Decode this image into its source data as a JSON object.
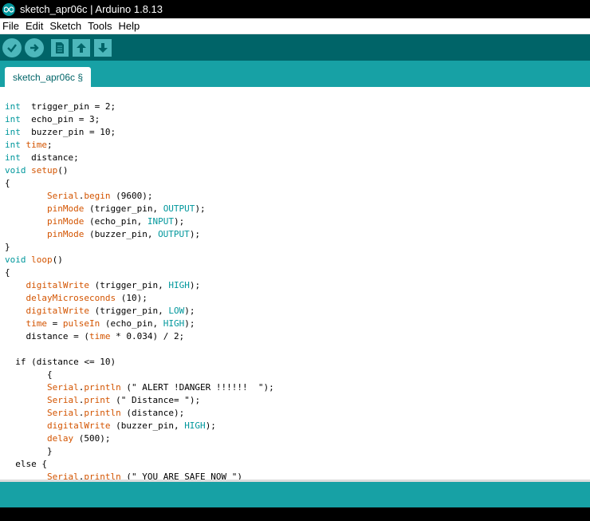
{
  "window": {
    "title": "sketch_apr06c | Arduino 1.8.13"
  },
  "menu": {
    "items": [
      "File",
      "Edit",
      "Sketch",
      "Tools",
      "Help"
    ]
  },
  "toolbar": {
    "buttons": [
      {
        "name": "verify-button",
        "icon": "checkmark-icon"
      },
      {
        "name": "upload-button",
        "icon": "arrow-right-icon"
      },
      {
        "name": "new-button",
        "icon": "document-icon"
      },
      {
        "name": "open-button",
        "icon": "arrow-up-icon"
      },
      {
        "name": "save-button",
        "icon": "arrow-down-icon"
      }
    ]
  },
  "tab": {
    "label": "sketch_apr06c §"
  },
  "colors": {
    "toolbar_bg": "#006468",
    "tab_bar_bg": "#17a1a5",
    "button_bg": "#4db7bb",
    "keyword": "#00979c",
    "function": "#d35400"
  },
  "code": [
    [
      [
        "kw",
        "int"
      ],
      [
        "",
        "  trigger_pin = 2;"
      ]
    ],
    [
      [
        "kw",
        "int"
      ],
      [
        "",
        "  echo_pin = 3;"
      ]
    ],
    [
      [
        "kw",
        "int"
      ],
      [
        "",
        "  buzzer_pin = 10;"
      ]
    ],
    [
      [
        "kw",
        "int"
      ],
      [
        "",
        " "
      ],
      [
        "fn",
        "time"
      ],
      [
        "",
        ";"
      ]
    ],
    [
      [
        "kw",
        "int"
      ],
      [
        "",
        "  distance;"
      ]
    ],
    [
      [
        "kw",
        "void"
      ],
      [
        "",
        " "
      ],
      [
        "fn",
        "setup"
      ],
      [
        "",
        "()"
      ]
    ],
    [
      [
        "",
        "{"
      ]
    ],
    [
      [
        "",
        "        "
      ],
      [
        "fn",
        "Serial"
      ],
      [
        "",
        "."
      ],
      [
        "fn",
        "begin"
      ],
      [
        "",
        " (9600);"
      ]
    ],
    [
      [
        "",
        "        "
      ],
      [
        "fn",
        "pinMode"
      ],
      [
        "",
        " (trigger_pin, "
      ],
      [
        "cn",
        "OUTPUT"
      ],
      [
        "",
        ");"
      ]
    ],
    [
      [
        "",
        "        "
      ],
      [
        "fn",
        "pinMode"
      ],
      [
        "",
        " (echo_pin, "
      ],
      [
        "cn",
        "INPUT"
      ],
      [
        "",
        ");"
      ]
    ],
    [
      [
        "",
        "        "
      ],
      [
        "fn",
        "pinMode"
      ],
      [
        "",
        " (buzzer_pin, "
      ],
      [
        "cn",
        "OUTPUT"
      ],
      [
        "",
        ");"
      ]
    ],
    [
      [
        "",
        "}"
      ]
    ],
    [
      [
        "kw",
        "void"
      ],
      [
        "",
        " "
      ],
      [
        "fn",
        "loop"
      ],
      [
        "",
        "()"
      ]
    ],
    [
      [
        "",
        "{"
      ]
    ],
    [
      [
        "",
        "    "
      ],
      [
        "fn",
        "digitalWrite"
      ],
      [
        "",
        " (trigger_pin, "
      ],
      [
        "cn",
        "HIGH"
      ],
      [
        "",
        ");"
      ]
    ],
    [
      [
        "",
        "    "
      ],
      [
        "fn",
        "delayMicroseconds"
      ],
      [
        "",
        " (10);"
      ]
    ],
    [
      [
        "",
        "    "
      ],
      [
        "fn",
        "digitalWrite"
      ],
      [
        "",
        " (trigger_pin, "
      ],
      [
        "cn",
        "LOW"
      ],
      [
        "",
        ");"
      ]
    ],
    [
      [
        "",
        "    "
      ],
      [
        "fn",
        "time"
      ],
      [
        "",
        " = "
      ],
      [
        "fn",
        "pulseIn"
      ],
      [
        "",
        " (echo_pin, "
      ],
      [
        "cn",
        "HIGH"
      ],
      [
        "",
        ");"
      ]
    ],
    [
      [
        "",
        "    distance = ("
      ],
      [
        "fn",
        "time"
      ],
      [
        "",
        " * 0.034) / 2;"
      ]
    ],
    [
      [
        "",
        ""
      ]
    ],
    [
      [
        "",
        "  if (distance <= 10)"
      ]
    ],
    [
      [
        "",
        "        {"
      ]
    ],
    [
      [
        "",
        "        "
      ],
      [
        "fn",
        "Serial"
      ],
      [
        "",
        "."
      ],
      [
        "fn",
        "println"
      ],
      [
        "",
        " (\" ALERT !DANGER !!!!!!  \");"
      ]
    ],
    [
      [
        "",
        "        "
      ],
      [
        "fn",
        "Serial"
      ],
      [
        "",
        "."
      ],
      [
        "fn",
        "print"
      ],
      [
        "",
        " (\" Distance= \");"
      ]
    ],
    [
      [
        "",
        "        "
      ],
      [
        "fn",
        "Serial"
      ],
      [
        "",
        "."
      ],
      [
        "fn",
        "println"
      ],
      [
        "",
        " (distance);"
      ]
    ],
    [
      [
        "",
        "        "
      ],
      [
        "fn",
        "digitalWrite"
      ],
      [
        "",
        " (buzzer_pin, "
      ],
      [
        "cn",
        "HIGH"
      ],
      [
        "",
        ");"
      ]
    ],
    [
      [
        "",
        "        "
      ],
      [
        "fn",
        "delay"
      ],
      [
        "",
        " (500);"
      ]
    ],
    [
      [
        "",
        "        }"
      ]
    ],
    [
      [
        "",
        "  else {"
      ]
    ],
    [
      [
        "",
        "        "
      ],
      [
        "fn",
        "Serial"
      ],
      [
        "",
        "."
      ],
      [
        "fn",
        "println"
      ],
      [
        "",
        " (\" YOU ARE SAFE NOW \")"
      ]
    ]
  ]
}
